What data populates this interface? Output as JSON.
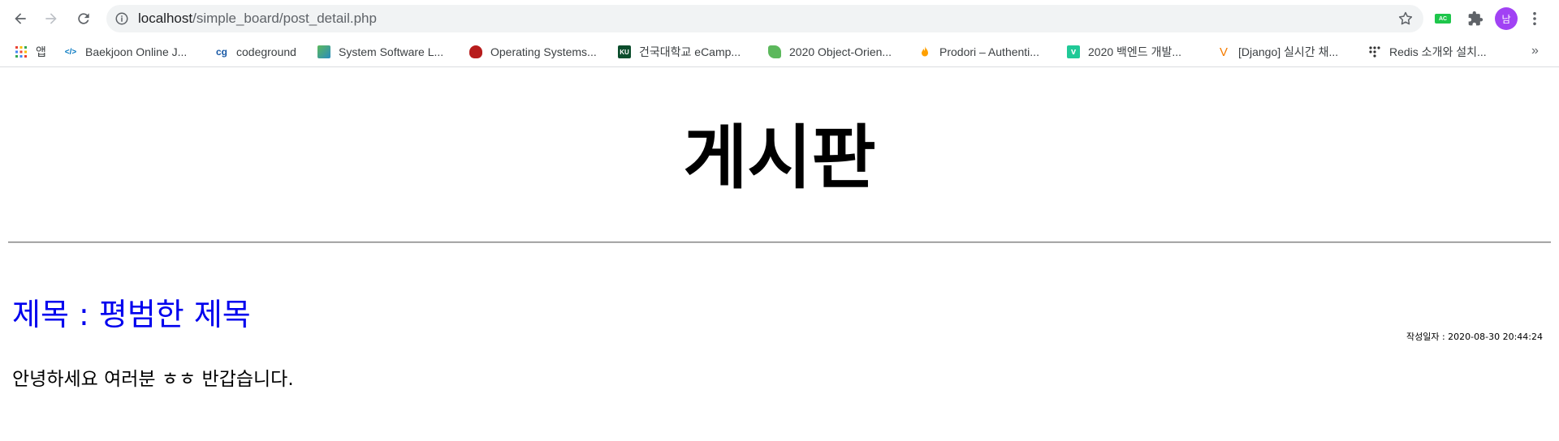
{
  "browser": {
    "url_host": "localhost",
    "url_path": "/simple_board/post_detail.php",
    "avatar_initial": "남",
    "ext_ac_label": "AC",
    "icons": {
      "back": "arrow-left-icon",
      "forward": "arrow-right-icon",
      "reload": "reload-icon",
      "info": "info-icon",
      "star": "star-icon",
      "puzzle": "puzzle-icon",
      "menu": "kebab-menu-icon"
    }
  },
  "bookmarks": {
    "items": [
      {
        "label": "앱",
        "icon": "apps-grid-icon"
      },
      {
        "label": "Baekjoon Online J...",
        "icon": "code-icon"
      },
      {
        "label": "codeground",
        "icon": "codeground-icon"
      },
      {
        "label": "System Software L...",
        "icon": "system-software-icon"
      },
      {
        "label": "Operating Systems...",
        "icon": "crest-icon"
      },
      {
        "label": "건국대학교 eCamp...",
        "icon": "ku-icon"
      },
      {
        "label": "2020 Object-Orien...",
        "icon": "leaf-icon"
      },
      {
        "label": "Prodori – Authenti...",
        "icon": "flame-icon"
      },
      {
        "label": "2020 백엔드 개발...",
        "icon": "v-square-icon"
      },
      {
        "label": "[Django] 실시간 채...",
        "icon": "v-letter-icon"
      },
      {
        "label": "Redis 소개와 설치...",
        "icon": "dots-tree-icon"
      }
    ],
    "more": "»"
  },
  "page": {
    "title": "게시판",
    "post_title": "제목 : 평범한 제목",
    "post_date": "작성일자 : 2020-08-30 20:44:24",
    "post_body": "안녕하세요 여러분 ㅎㅎ 반갑습니다."
  },
  "colors": {
    "link": "#0000ee",
    "omnibox_bg": "#f1f3f4",
    "avatar": "#a142f4",
    "ac_badge": "#1ec64b"
  }
}
